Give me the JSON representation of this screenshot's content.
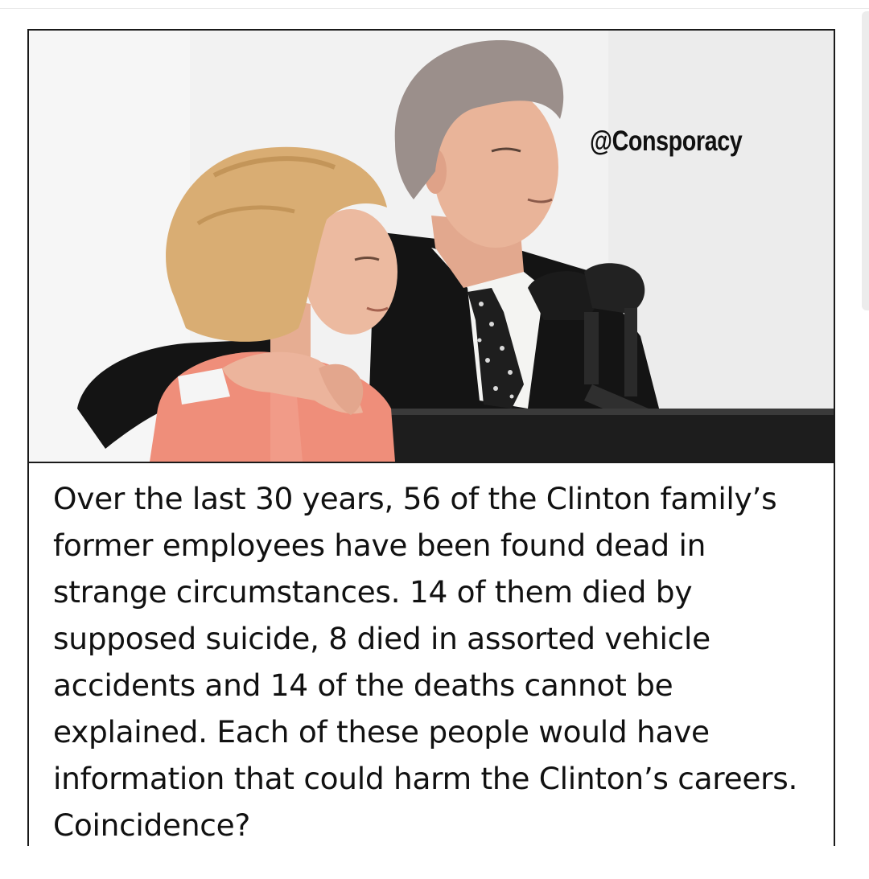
{
  "post": {
    "watermark": "@Consporacy",
    "caption": "Over the last 30 years, 56 of the Clinton family’s former employees have been found dead in strange circumstances. 14 of them died by supposed suicide, 8 died in assorted vehicle accidents and 14 of the deaths cannot be explained. Each of these people would have information that could harm the Clinton’s careers. Coincidence?"
  },
  "colors": {
    "background": "#ffffff",
    "frame": "#1a1a1a",
    "text": "#111111",
    "photo_backdrop": "#f1f1f1",
    "suit": "#141414",
    "jacket_pink": "#ef8e7a",
    "hair_blonde": "#d9ad73",
    "hair_grey": "#9b8f8b",
    "skin": "#e8b49a"
  }
}
